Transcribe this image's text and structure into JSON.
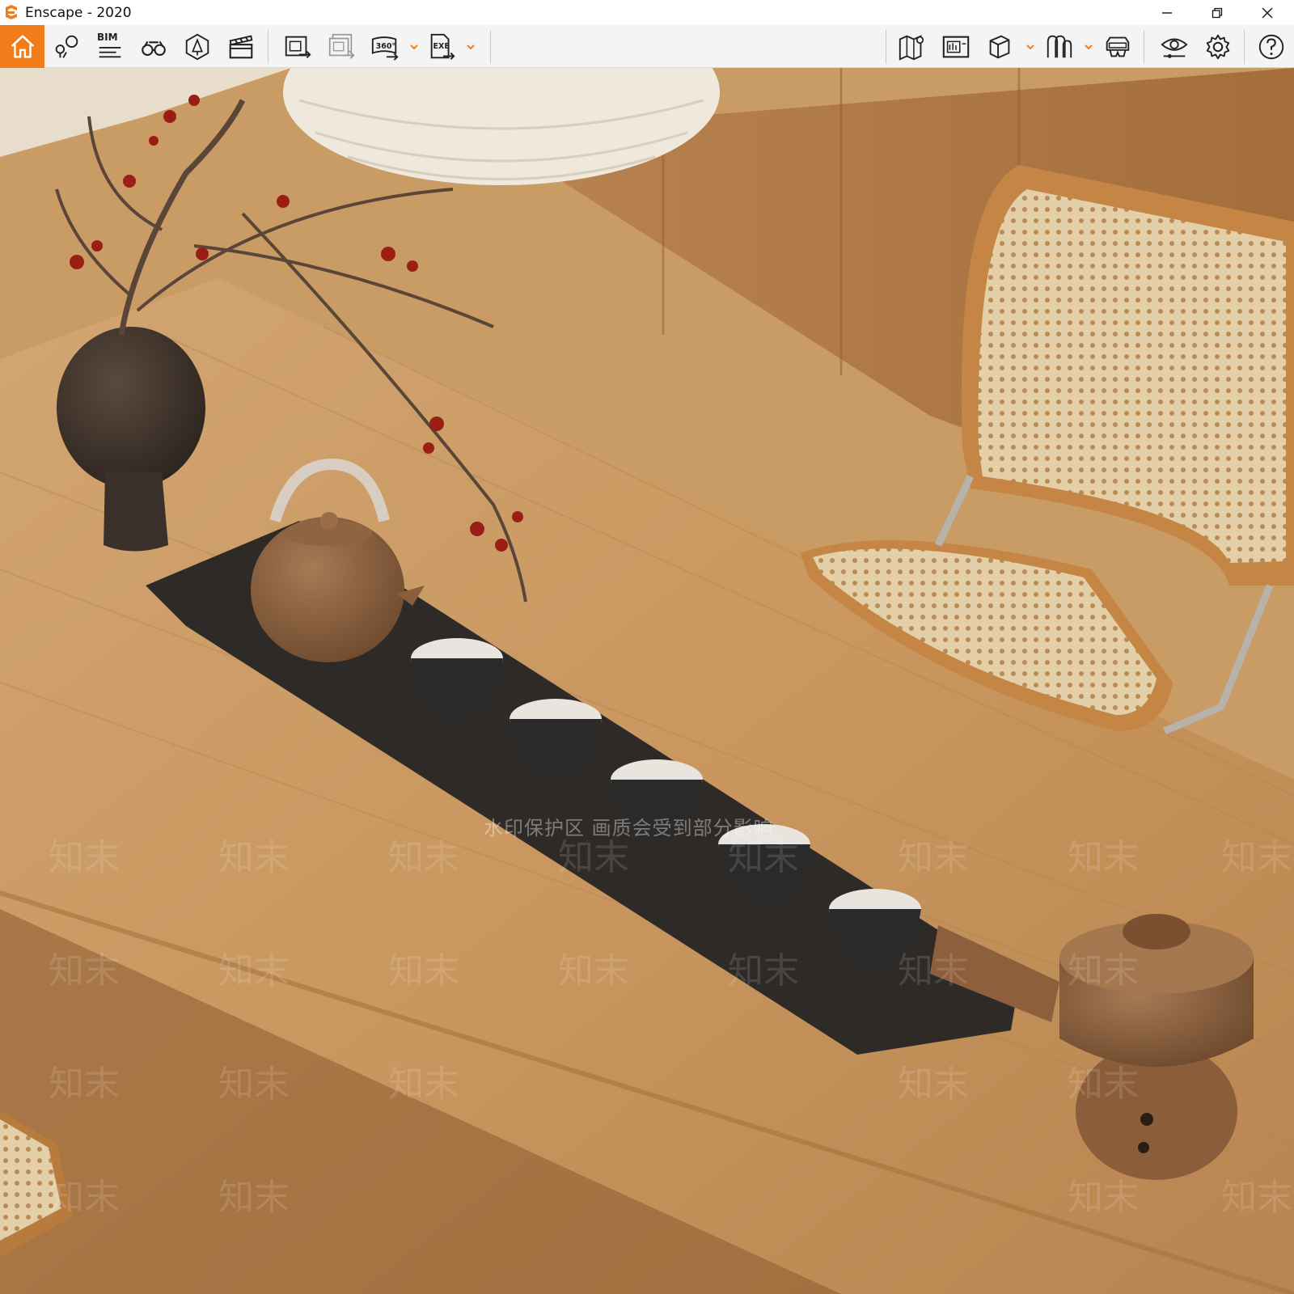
{
  "window": {
    "title": "Enscape - 2020",
    "app_icon": "enscape-logo-icon",
    "controls": [
      "minimize-icon",
      "restore-icon",
      "close-icon"
    ]
  },
  "toolbar": {
    "accent_color": "#f07d1a",
    "bim_label": "BIM",
    "icon_360_label": "360°",
    "icon_exe_label": "EXE",
    "left_tools": [
      "home-icon",
      "location-pins-icon",
      "bim-info-icon",
      "binoculars-icon",
      "asset-library-icon",
      "video-editor-icon",
      "screenshot-export-icon",
      "batch-render-icon",
      "panorama-360-icon",
      "exe-export-icon"
    ],
    "right_tools": [
      "map-icon",
      "gallery-icon",
      "cube-view-icon",
      "collaboration-icon",
      "vr-headset-icon",
      "visual-settings-icon",
      "settings-gear-icon",
      "help-icon"
    ]
  },
  "viewport": {
    "scene": "rendered-interior-tea-table",
    "watermark_note": "水印保护区 画质会受到部分影响",
    "watermark_text": "知末"
  }
}
